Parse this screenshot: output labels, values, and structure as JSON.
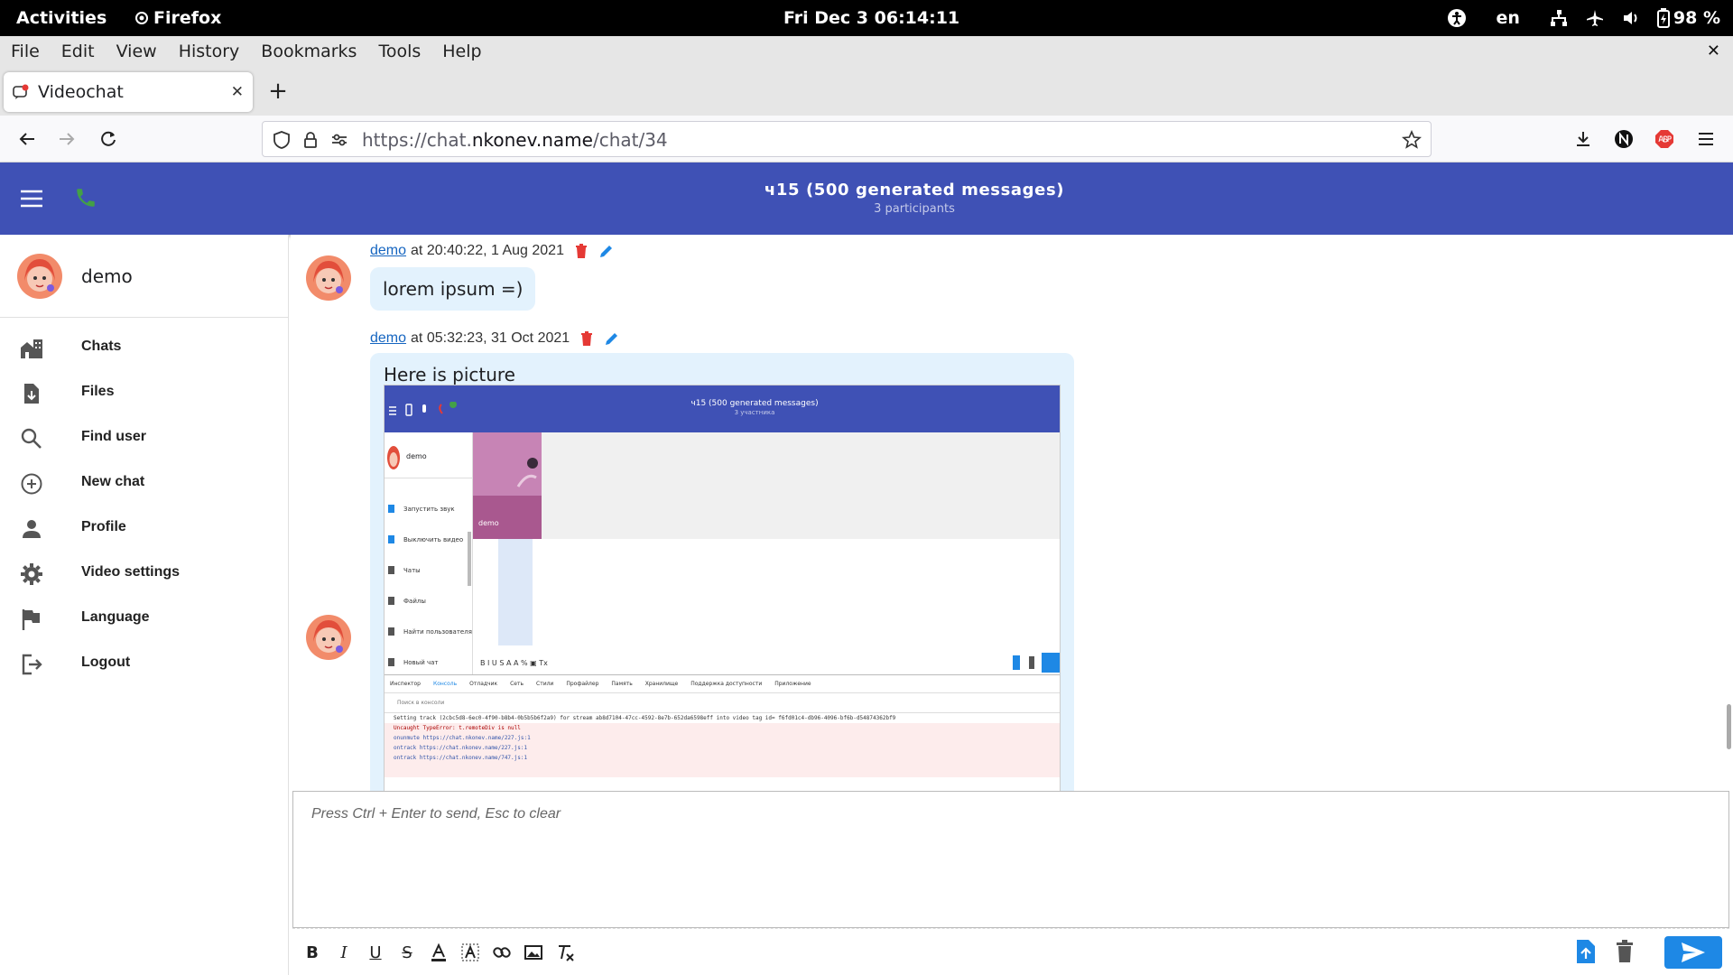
{
  "system_bar": {
    "activities": "Activities",
    "app_name": "Firefox",
    "clock": "Fri Dec 3  06:14:11",
    "lang": "en",
    "battery": "98 %"
  },
  "menu": [
    "File",
    "Edit",
    "View",
    "History",
    "Bookmarks",
    "Tools",
    "Help"
  ],
  "tab": {
    "title": "Videochat"
  },
  "address": {
    "prefix": "https://chat.",
    "domain": "nkonev.name",
    "path": "/chat/34"
  },
  "appbar": {
    "title": "ч15 (500 generated messages)",
    "subtitle": "3 participants"
  },
  "sidebar": {
    "user_name": "demo",
    "items": [
      {
        "label": "Chats",
        "icon": "chats-icon"
      },
      {
        "label": "Files",
        "icon": "files-icon"
      },
      {
        "label": "Find user",
        "icon": "search-icon"
      },
      {
        "label": "New chat",
        "icon": "plus-circle-icon"
      },
      {
        "label": "Profile",
        "icon": "person-icon"
      },
      {
        "label": "Video settings",
        "icon": "gear-icon"
      },
      {
        "label": "Language",
        "icon": "flag-icon"
      },
      {
        "label": "Logout",
        "icon": "logout-icon"
      }
    ]
  },
  "messages": [
    {
      "author": "demo",
      "meta": "at 20:40:22, 1 Aug 2021",
      "text": "lorem ipsum =)"
    },
    {
      "author": "demo",
      "meta": "at 05:32:23, 31 Oct 2021",
      "text": "Here is picture"
    }
  ],
  "embedded_screenshot": {
    "title": "ч15 (500 generated messages)",
    "subtitle": "3 участника",
    "user": "demo",
    "video_label": "demo",
    "side_items": [
      "Запустить звук",
      "Выключить видео",
      "Чаты",
      "Файлы",
      "Найти пользователя",
      "Новый чат"
    ],
    "devtools_tabs": [
      "Инспектор",
      "Консоль",
      "Отладчик",
      "Сеть",
      "Стили",
      "Профайлер",
      "Память",
      "Хранилище",
      "Поддержка доступности",
      "Приложение"
    ],
    "filter_placeholder": "Поиск в консоли",
    "log_line": "Setting track (2cbc5d8-6ec0-4f90-b8b4-0b5b5b6f2a9) for stream ab8d7104-47cc-4592-8e7b-652da6598eff into video tag id= f6fd01c4-db96-4096-bf6b-d54874362bf9",
    "error_lines": [
      "Uncaught TypeError: t.remoteDiv is null",
      "onunmute https://chat.nkonev.name/227.js:1",
      "ontrack https://chat.nkonev.name/227.js:1",
      "ontrack https://chat.nkonev.name/747.js:1"
    ]
  },
  "composer": {
    "placeholder": "Press Ctrl + Enter to send, Esc to clear"
  },
  "colors": {
    "appbar": "#3f51b5",
    "bubble": "#e3f2fd",
    "link": "#1565c0",
    "delete": "#e53935",
    "edit": "#1e88e5",
    "phone": "#43a047"
  }
}
